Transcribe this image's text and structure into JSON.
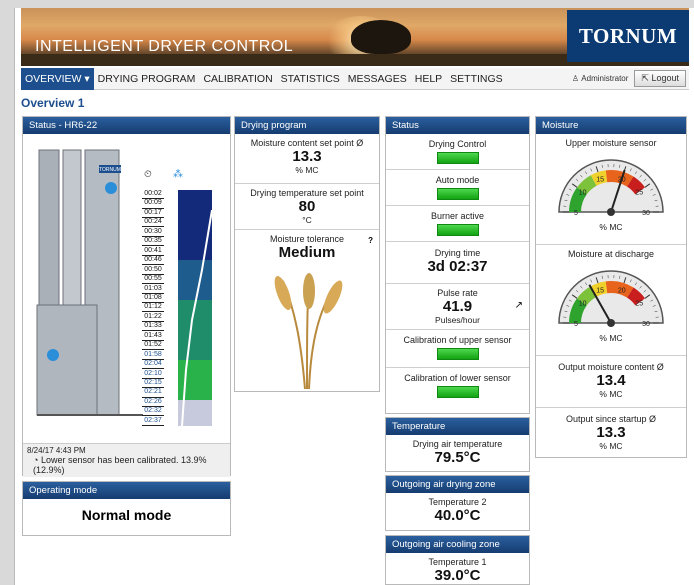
{
  "header": {
    "title": "INTELLIGENT DRYER CONTROL",
    "logo_text": "TORNUM"
  },
  "nav": {
    "items": [
      "OVERVIEW",
      "DRYING PROGRAM",
      "CALIBRATION",
      "STATISTICS",
      "MESSAGES",
      "HELP",
      "SETTINGS"
    ],
    "user": "Administrator",
    "logout": "Logout"
  },
  "page_title": "Overview 1",
  "status_panel": {
    "title": "Status - HR6-22",
    "dryer_label": "TORNUM",
    "times": [
      "00:02",
      "00:09",
      "00:17",
      "00:24",
      "00:30",
      "00:35",
      "00:41",
      "00:46",
      "00:50",
      "00:55",
      "01:03",
      "01:08",
      "01:12",
      "01:22",
      "01:33",
      "01:43",
      "01:52",
      "01:58",
      "02:04",
      "02:10",
      "02:15",
      "02:21",
      "02:26",
      "02:32",
      "02:37"
    ],
    "message_time": "8/24/17 4:43 PM",
    "message_text": "Lower sensor has been calibrated. 13.9% (12.9%)"
  },
  "operating_mode": {
    "title": "Operating mode",
    "value": "Normal mode"
  },
  "drying_program": {
    "title": "Drying program",
    "moisture_setpoint_label": "Moisture content set point Ø",
    "moisture_setpoint_value": "13.3",
    "moisture_setpoint_unit": "% MC",
    "temp_setpoint_label": "Drying temperature set point",
    "temp_setpoint_value": "80",
    "temp_setpoint_unit": "°C",
    "tolerance_label": "Moisture tolerance",
    "tolerance_help": "?",
    "tolerance_value": "Medium"
  },
  "status": {
    "title": "Status",
    "drying_control": "Drying Control",
    "auto_mode": "Auto mode",
    "burner_active": "Burner active",
    "drying_time_label": "Drying time",
    "drying_time_value": "3d 02:37",
    "pulse_rate_label": "Pulse rate",
    "pulse_rate_value": "41.9",
    "pulse_rate_unit": "Pulses/hour",
    "calib_upper": "Calibration of upper sensor",
    "calib_lower": "Calibration of lower sensor"
  },
  "temperature": {
    "title": "Temperature",
    "label": "Drying air temperature",
    "value": "79.5°C"
  },
  "outgoing_drying": {
    "title": "Outgoing air drying zone",
    "label": "Temperature 2",
    "value": "40.0°C"
  },
  "outgoing_cooling": {
    "title": "Outgoing air cooling zone",
    "label": "Temperature 1",
    "value": "39.0°C"
  },
  "moisture": {
    "title": "Moisture",
    "upper_label": "Upper moisture sensor",
    "upper_unit": "% MC",
    "upper_value": 20,
    "discharge_label": "Moisture at discharge",
    "discharge_unit": "% MC",
    "discharge_value": 13.4,
    "gauge_ticks": [
      "5",
      "10",
      "15",
      "20",
      "25",
      "30"
    ],
    "output_label": "Output moisture content Ø",
    "output_value": "13.4",
    "output_unit": "% MC",
    "since_label": "Output since startup Ø",
    "since_value": "13.3",
    "since_unit": "% MC"
  },
  "colors": {
    "header_blue": "#1d4f8e",
    "status_green": "#22b422"
  }
}
